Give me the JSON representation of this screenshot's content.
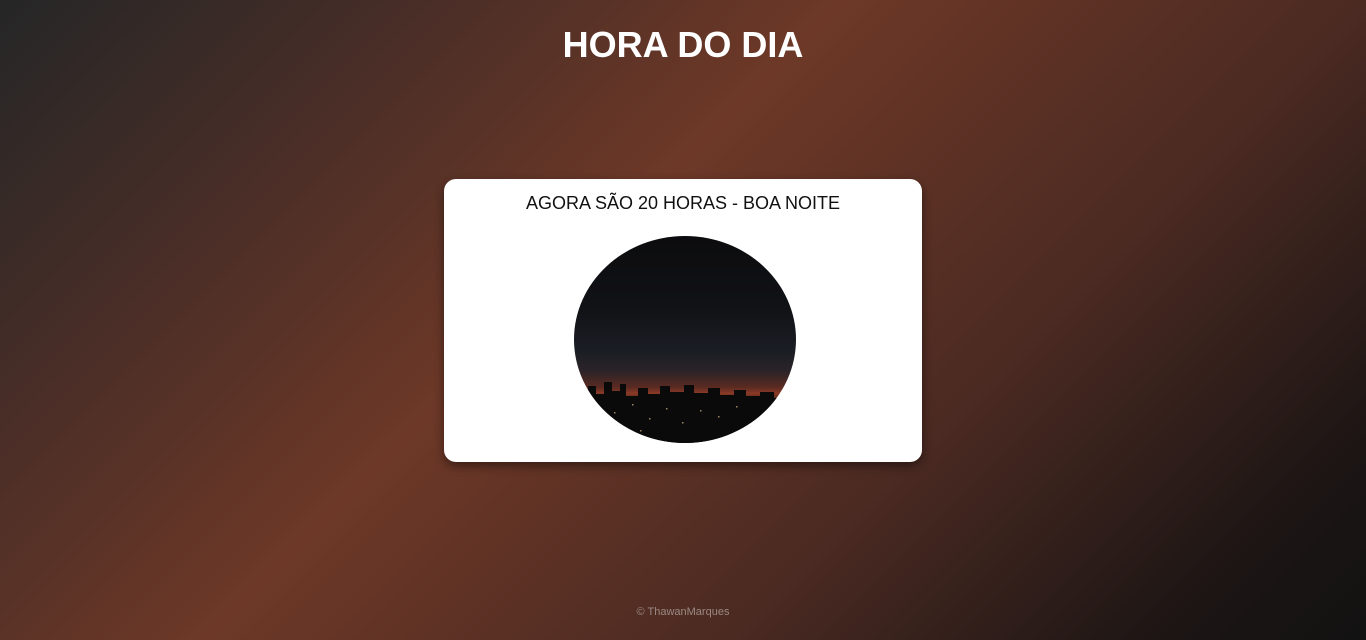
{
  "header": {
    "title": "HORA DO DIA"
  },
  "card": {
    "message": "AGORA SÃO 20 HORAS - BOA NOITE",
    "image_description": "night-city-skyline"
  },
  "footer": {
    "copyright": "© ThawanMarques"
  },
  "colors": {
    "title_text": "#ffffff",
    "card_background": "#ffffff",
    "footer_text": "#9a8a84"
  }
}
